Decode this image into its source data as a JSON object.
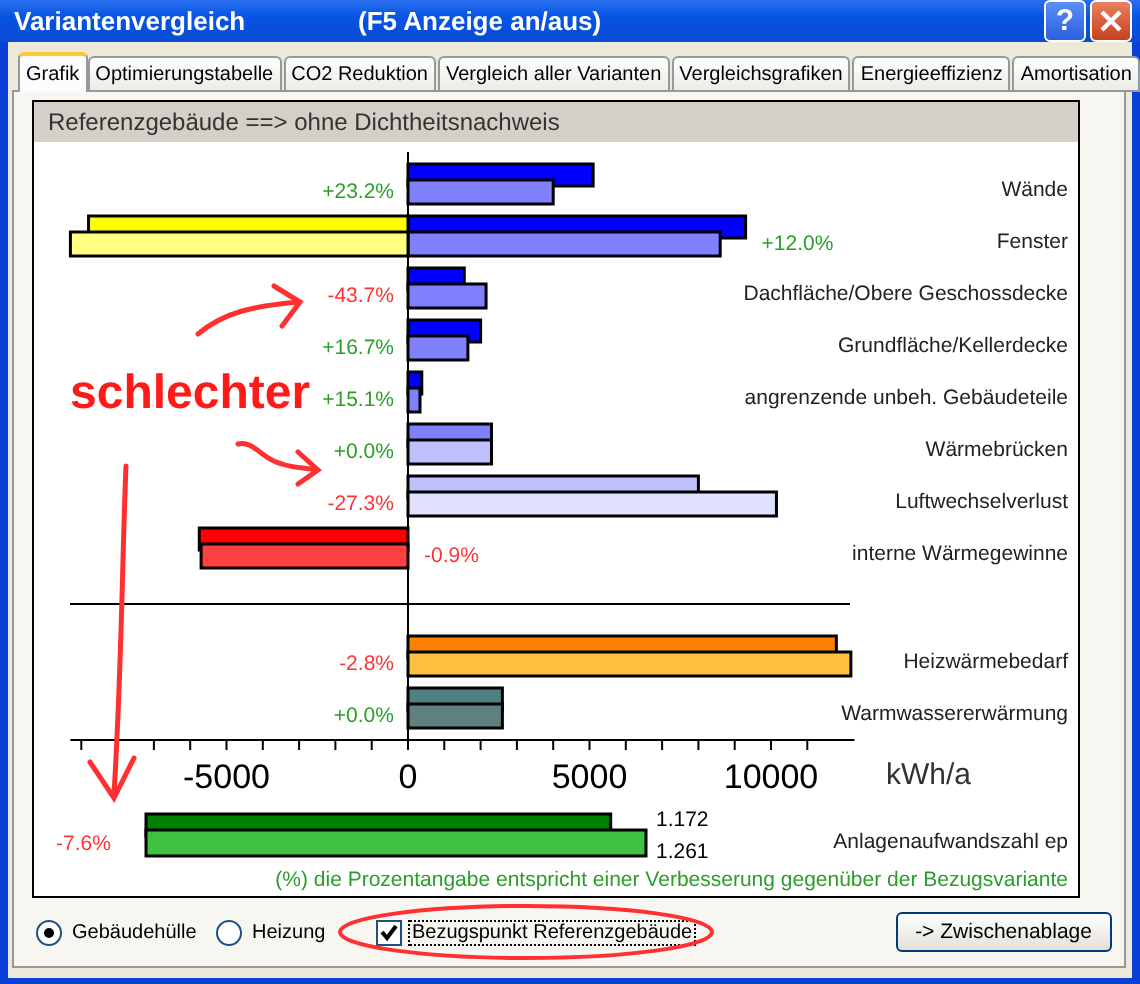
{
  "window": {
    "title": "Variantenvergleich",
    "hint": "(F5 Anzeige an/aus)",
    "buttons": [
      {
        "kind": "help",
        "label": "?"
      },
      {
        "kind": "close"
      }
    ]
  },
  "tabs": [
    {
      "label": "Grafik",
      "selected": true
    },
    {
      "label": "Optimierungstabelle",
      "selected": false
    },
    {
      "label": "CO2 Reduktion",
      "selected": false
    },
    {
      "label": "Vergleich aller Varianten",
      "selected": false
    },
    {
      "label": "Vergleichsgrafiken",
      "selected": false
    },
    {
      "label": "Energieeffizienz",
      "selected": false
    },
    {
      "label": "Amortisation",
      "selected": false
    }
  ],
  "panel": {
    "heading": "Referenzgebäude ==> ohne Dichtheitsnachweis",
    "chart": {
      "groups": [
        {
          "rows": [
            {
              "change": "+23.2%",
              "improved": true
            },
            {
              "change": "+12.0%",
              "improved": true
            },
            {
              "change": "-43.7%",
              "improved": false
            },
            {
              "change": "+16.7%",
              "improved": true
            },
            {
              "change": "+15.1%",
              "improved": true
            },
            {
              "change": "+0.0%",
              "improved": true
            },
            {
              "change": "-27.3%",
              "improved": false
            },
            {
              "change": "-0.9%",
              "improved": false
            }
          ]
        },
        {
          "rows": [
            {
              "change": "-2.8%",
              "improved": false
            },
            {
              "change": "+0.0%",
              "improved": true
            }
          ]
        }
      ],
      "chart_data": {
        "type": "bar",
        "orientation": "horizontal",
        "xlabel": "kWh/a",
        "xlim": [
          -9300,
          12300
        ],
        "xticks": [
          -5000,
          0,
          5000,
          10000
        ],
        "categories": [
          "Wände",
          "Fenster",
          "Dachfläche/Obere Geschossdecke",
          "Grundfläche/Kellerdecke",
          "angrenzende unbeh. Gebäudeteile",
          "Wärmebrücken",
          "Luftwechselverlust",
          "interne Wärmegewinne",
          "Heizwärmebedarf",
          "Warmwassererwärmung"
        ],
        "series": [
          {
            "values": [
              5100,
              9300,
              1550,
              2000,
              380,
              2300,
              8000,
              null,
              11800,
              2600
            ],
            "colors": [
              "#0000ff",
              "#0000ff",
              "#0000ff",
              "#0000ff",
              "#0000ff",
              "#8080ff",
              "#c0c0ff",
              null,
              "#ff8000",
              "#508080"
            ]
          },
          {
            "values": [
              null,
              -8800,
              null,
              null,
              null,
              null,
              null,
              -5750,
              null,
              null
            ],
            "colors": [
              null,
              "#ffff00",
              null,
              null,
              null,
              null,
              null,
              "#ff0000",
              null,
              null
            ]
          },
          {
            "values": [
              4000,
              8600,
              2150,
              1650,
              330,
              2300,
              10150,
              null,
              12200,
              2600
            ],
            "colors": [
              "#8080ff",
              "#8080ff",
              "#8080ff",
              "#8080ff",
              "#8080ff",
              "#c0c0ff",
              "#e0e0ff",
              null,
              "#ffc040",
              "#608080"
            ]
          },
          {
            "values": [
              null,
              -9300,
              null,
              null,
              null,
              null,
              null,
              -5700,
              null,
              null
            ],
            "colors": [
              null,
              "#ffff80",
              null,
              null,
              null,
              null,
              null,
              "#ff4040",
              null,
              null
            ]
          }
        ]
      }
    },
    "efficiency": {
      "label": "Anlagenaufwandszahl ep",
      "change": "-7.6%",
      "improved": false,
      "bars": [
        {
          "value": "1.172",
          "color": "#008000"
        },
        {
          "value": "1.261",
          "color": "#40c040"
        }
      ]
    },
    "note": "(%) die Prozentangabe entspricht einer Verbesserung gegenüber der Bezugsvariante",
    "annotation": {
      "text": "schlechter"
    }
  },
  "options": {
    "radios": [
      {
        "label": "Gebäudehülle",
        "selected": true
      },
      {
        "label": "Heizung",
        "selected": false
      }
    ],
    "checkbox": {
      "label": "Bezugspunkt Referenzgebäude",
      "checked": true,
      "circled": true
    },
    "button": "-> Zwischenablage"
  }
}
